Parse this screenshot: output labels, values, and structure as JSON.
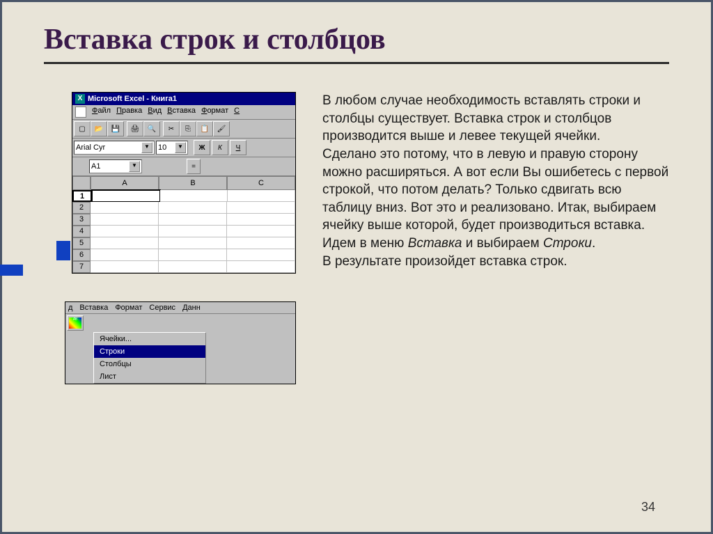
{
  "title": "Вставка строк и столбцов",
  "body_text": "В любом случае необходимость вставлять строки и столбцы существует. Вставка строк и столбцов производится выше и левее текущей ячейки.\nСделано это потому, что в левую и правую сторону можно расширяться. А вот если Вы ошибетесь с первой строкой, что потом делать? Только сдвигать всю таблицу вниз. Вот это и реализовано. Итак, выбираем ячейку выше которой, будет производиться вставка.",
  "body_text2_prefix": "Идем в меню ",
  "body_text2_italic1": "Вставка",
  "body_text2_mid": " и выбираем ",
  "body_text2_italic2": "Строки",
  "body_text2_suffix": ".",
  "body_text3": "В результате произойдет вставка строк.",
  "page_number": "34",
  "excel1": {
    "title": "Microsoft Excel - Книга1",
    "menus": [
      "Файл",
      "Правка",
      "Вид",
      "Вставка",
      "Формат",
      "С"
    ],
    "font": "Arial Cyr",
    "font_size": "10",
    "bold": "Ж",
    "italic": "К",
    "underline": "Ч",
    "namebox": "A1",
    "equals": "=",
    "cols": [
      "A",
      "B",
      "C"
    ],
    "rows": [
      "1",
      "2",
      "3",
      "4",
      "5",
      "6",
      "7"
    ]
  },
  "excel2": {
    "menus": [
      "д",
      "Вставка",
      "Формат",
      "Сервис",
      "Данн"
    ],
    "menu_items": [
      "Ячейки...",
      "Строки",
      "Столбцы",
      "Лист"
    ]
  }
}
